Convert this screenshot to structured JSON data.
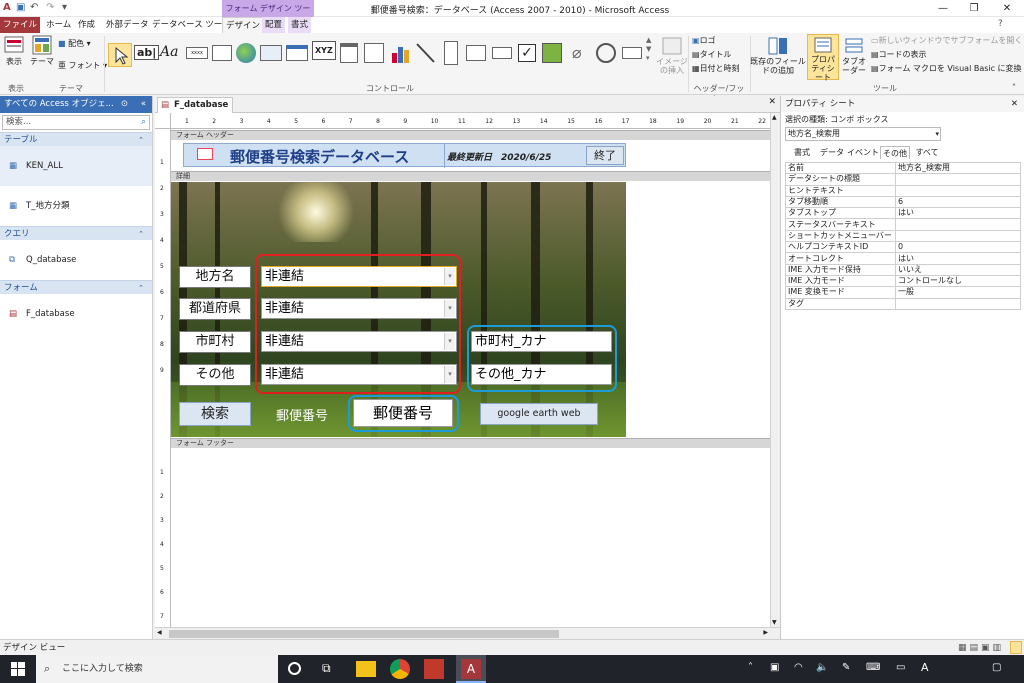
{
  "window": {
    "title": "郵便番号検索：データベース (Access 2007 - 2010) - Microsoft Access",
    "contextual_group": "フォーム デザイン ツール",
    "controls": [
      "—",
      "❐",
      "✕"
    ]
  },
  "ribbon_tabs": [
    {
      "label": "ファイル"
    },
    {
      "label": "ホーム"
    },
    {
      "label": "作成"
    },
    {
      "label": "外部データ"
    },
    {
      "label": "データベース ツール"
    },
    {
      "label": "デザイン"
    },
    {
      "label": "配置"
    },
    {
      "label": "書式"
    }
  ],
  "ribbon": {
    "view_label": "表示",
    "theme_label": "テーマ",
    "colors_label": "配色",
    "fonts_label": "フォント",
    "group_view": "表示",
    "group_theme": "テーマ",
    "group_controls": "コントロール",
    "image_insert": "イメージの挿入",
    "logo": "ロゴ",
    "title": "タイトル",
    "datetime": "日付と時刻",
    "group_header": "ヘッダー/フッター",
    "add_fields": "既存のフィールドの追加",
    "property_sheet": "プロパティシート",
    "tab_order": "タブオーダー",
    "subform_new_window": "新しいウィンドウでサブフォームを開く",
    "view_code": "コードの表示",
    "convert_macros": "フォーム マクロを Visual Basic に変換",
    "group_tools": "ツール"
  },
  "nav": {
    "header": "すべての Access オブジェ...",
    "search_placeholder": "検索...",
    "categories": [
      {
        "label": "テーブル",
        "items": [
          "KEN_ALL",
          "T_地方分類"
        ]
      },
      {
        "label": "クエリ",
        "items": [
          "Q_database"
        ]
      },
      {
        "label": "フォーム",
        "items": [
          "F_database"
        ]
      }
    ]
  },
  "document": {
    "tab_label": "F_database",
    "section_header": "フォーム ヘッダー",
    "section_detail": "詳細",
    "section_footer": "フォーム フッター",
    "form_title": "郵便番号検索データベース",
    "last_updated": "最終更新日　2020/6/25",
    "exit_button": "終了",
    "rows": [
      {
        "label": "地方名",
        "value": "非連結"
      },
      {
        "label": "都道府県",
        "value": "非連結"
      },
      {
        "label": "市町村",
        "value": "非連結",
        "kana": "市町村_カナ"
      },
      {
        "label": "その他",
        "value": "非連結",
        "kana": "その他_カナ"
      }
    ],
    "search_button": "検索",
    "postal_label": "郵便番号",
    "postal_field": "郵便番号",
    "google_button": "google earth web",
    "ruler_h": [
      "1",
      "2",
      "3",
      "4",
      "5",
      "6",
      "7",
      "8",
      "9",
      "10",
      "11",
      "12",
      "13",
      "14",
      "15",
      "16",
      "17",
      "18",
      "19",
      "20",
      "21",
      "22"
    ],
    "ruler_v": [
      "1",
      "2",
      "3",
      "4",
      "5",
      "6",
      "7",
      "8",
      "9",
      "1",
      "2",
      "3",
      "4",
      "5",
      "6",
      "7",
      "8",
      "9"
    ],
    "colors": {
      "red_box": "#e02020",
      "blue_box": "#1e9bd7"
    }
  },
  "property_sheet": {
    "title": "プロパティ シート",
    "selection_type": "選択の種類: コンボ ボックス",
    "selected_control": "地方名_検索用",
    "tabs": [
      "書式",
      "データ",
      "イベント",
      "その他",
      "すべて"
    ],
    "active_tab": "その他",
    "rows": [
      [
        "名前",
        "地方名_検索用"
      ],
      [
        "データシートの標題",
        ""
      ],
      [
        "ヒントテキスト",
        ""
      ],
      [
        "タブ移動順",
        "6"
      ],
      [
        "タブストップ",
        "はい"
      ],
      [
        "ステータスバーテキスト",
        ""
      ],
      [
        "ショートカットメニューバー",
        ""
      ],
      [
        "ヘルプコンテキストID",
        "0"
      ],
      [
        "オートコレクト",
        "はい"
      ],
      [
        "IME 入力モード保持",
        "いいえ"
      ],
      [
        "IME 入力モード",
        "コントロールなし"
      ],
      [
        "IME 変換モード",
        "一般"
      ],
      [
        "タグ",
        ""
      ]
    ]
  },
  "statusbar": {
    "text": "デザイン ビュー"
  },
  "taskbar": {
    "search_placeholder": "ここに入力して検索",
    "ime": "A"
  }
}
